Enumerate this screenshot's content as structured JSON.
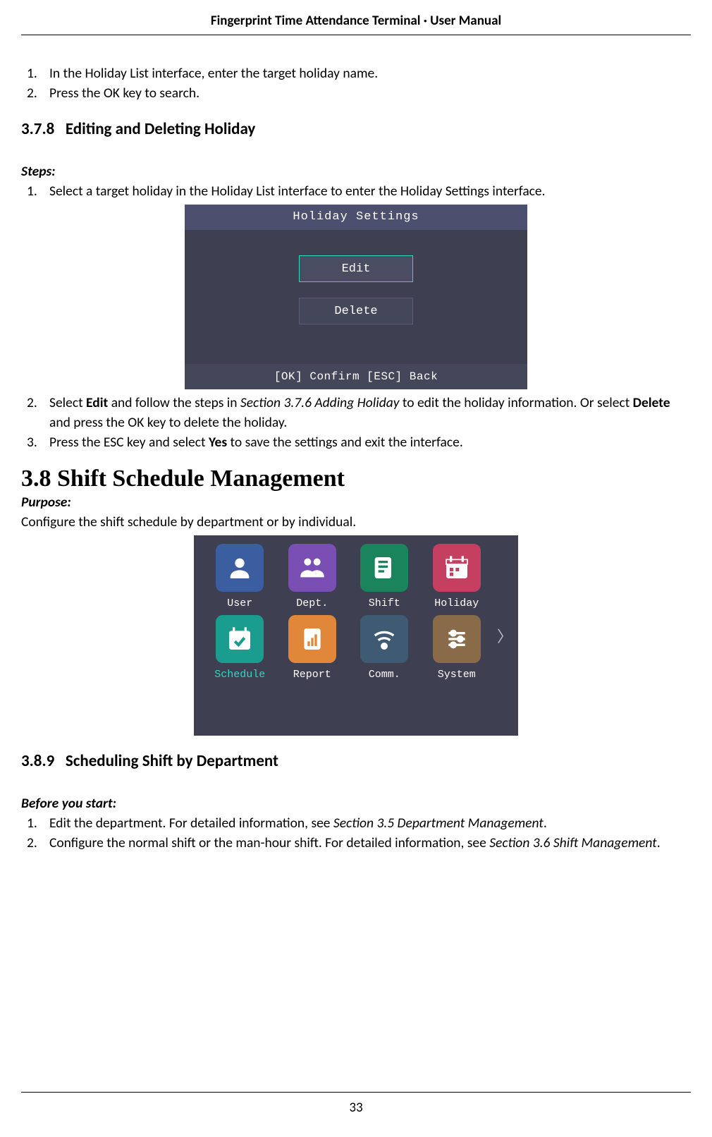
{
  "header": "Fingerprint Time Attendance Terminal · User Manual",
  "page_num": "33",
  "top_list": [
    {
      "n": "1.",
      "t": "In the Holiday List interface, enter the target holiday name."
    },
    {
      "n": "2.",
      "t": "Press the OK key to search."
    }
  ],
  "sec378": {
    "num": "3.7.8",
    "title": "Editing and Deleting Holiday",
    "steps_label": "Steps:",
    "step1": {
      "n": "1.",
      "t": "Select a target holiday in the Holiday List interface to enter the Holiday Settings interface."
    },
    "shot": {
      "title": "Holiday Settings",
      "edit": "Edit",
      "delete": "Delete",
      "footer": "[OK] Confirm   [ESC] Back"
    },
    "step2": {
      "n": "2.",
      "pre": "Select ",
      "b1": "Edit",
      "mid": " and follow the steps in ",
      "i1": "Section 3.7.6 Adding Holiday",
      "post": " to edit the holiday information. Or select ",
      "b2": "Delete",
      "post2": " and press the OK key to delete the holiday."
    },
    "step3": {
      "n": "3.",
      "pre": "Press the ESC key and select ",
      "b1": "Yes",
      "post": " to save the settings and exit the interface."
    }
  },
  "sec38": {
    "num": "3.8",
    "title": "Shift Schedule Management",
    "purpose_label": "Purpose:",
    "purpose_text": "Configure the shift schedule by department or by individual.",
    "tiles": [
      {
        "label": "User",
        "color": "#3a5ea0"
      },
      {
        "label": "Dept.",
        "color": "#7a4fb3"
      },
      {
        "label": "Shift",
        "color": "#1a845c"
      },
      {
        "label": "Holiday",
        "color": "#c54060"
      },
      {
        "label": "Schedule",
        "color": "#1a9d8f",
        "selected": true
      },
      {
        "label": "Report",
        "color": "#e0873a"
      },
      {
        "label": "Comm.",
        "color": "#3f5a73"
      },
      {
        "label": "System",
        "color": "#8a6b49"
      }
    ]
  },
  "sec389": {
    "num": "3.8.9",
    "title": "Scheduling Shift by Department",
    "before_label": "Before you start:",
    "item1": {
      "n": "1.",
      "pre": "Edit the department. For detailed information, see ",
      "i": "Section 3.5 Department Management",
      "post": "."
    },
    "item2": {
      "n": "2.",
      "pre": "Configure the normal shift or the man-hour shift. For detailed information, see ",
      "i": "Section 3.6 Shift Management",
      "post": "."
    }
  }
}
